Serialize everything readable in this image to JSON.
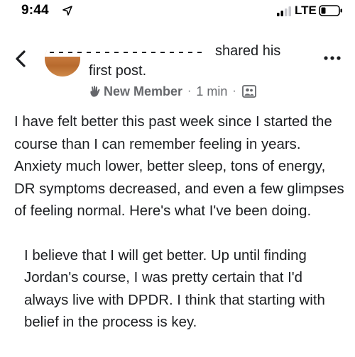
{
  "status_bar": {
    "time": "9:44",
    "network": "LTE",
    "icons": [
      "location-arrow-icon",
      "cellular-signal-icon",
      "battery-icon"
    ]
  },
  "header": {
    "back_icon": "chevron-left-icon",
    "author_name": "",
    "headline_action": "shared his",
    "headline_rest": "first post.",
    "more_icon": "more-horizontal-icon",
    "meta": {
      "badge": "New Member",
      "separator": "·",
      "time_ago": "1 min",
      "separator_2": "·",
      "privacy_icon": "group-privacy-icon"
    }
  },
  "post": {
    "paragraphs": [
      "I have felt better this past week since I started the course than I can remember feeling in years. Anxiety much lower, better sleep, tons of energy, DR symptoms decreased, and even a few glimpses of feeling normal. Here's what I've been doing.",
      "I believe that I will get better. Up until finding Jordan's course, I was pretty certain that I'd always live with DPDR. I think that starting with belief in the process is key."
    ]
  },
  "colors": {
    "text": "#1c1e21",
    "secondary": "#65676b",
    "background": "#ffffff"
  }
}
